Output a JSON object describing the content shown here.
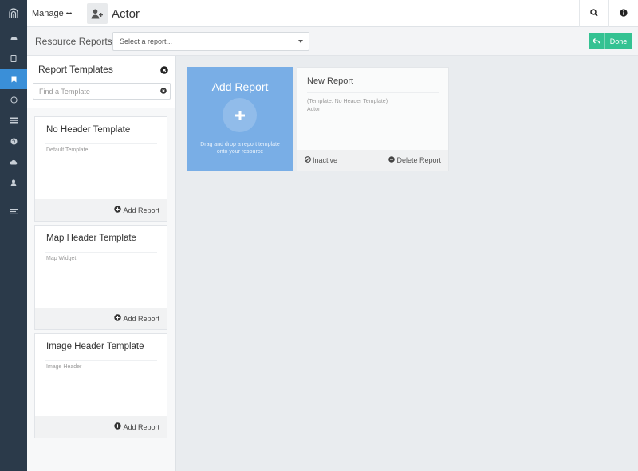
{
  "header": {
    "manage_label": "Manage",
    "more_glyph": "•••",
    "title": "Actor",
    "title_icon": "user-add-icon",
    "search_icon": "search-icon",
    "info_icon": "info-icon"
  },
  "nav": {
    "logo_icon": "logo-arch-icon",
    "items": [
      {
        "icon": "dashboard-icon",
        "active": false
      },
      {
        "icon": "book-icon",
        "active": false
      },
      {
        "icon": "bookmark-icon",
        "active": true
      },
      {
        "icon": "clock-icon",
        "active": false
      },
      {
        "icon": "list-icon",
        "active": false
      },
      {
        "icon": "globe-icon",
        "active": false
      },
      {
        "icon": "cloud-icon",
        "active": false
      },
      {
        "icon": "user-icon",
        "active": false
      },
      {
        "icon": "menu-lines-icon",
        "active": false
      }
    ]
  },
  "resource_bar": {
    "label": "Resource Reports",
    "select_value": "Select a report...",
    "done_label": "Done"
  },
  "templates": {
    "title": "Report Templates",
    "search_placeholder": "Find a Template",
    "items": [
      {
        "name": "No Header Template",
        "description": "Default Template",
        "action": "Add Report"
      },
      {
        "name": "Map Header Template",
        "description": "Map Widget",
        "action": "Add Report"
      },
      {
        "name": "Image Header Template",
        "description": "Image Header",
        "action": "Add Report"
      }
    ]
  },
  "main": {
    "add_report": {
      "title": "Add Report",
      "help": "Drag and drop a report template onto your resource"
    },
    "report_card": {
      "name": "New Report",
      "template": "(Template: No Header Template)",
      "resource": "Actor",
      "status": "Inactive",
      "delete_label": "Delete Report"
    }
  },
  "colors": {
    "nav_bg": "#2b3a4a",
    "nav_active": "#3a8fd8",
    "done_green": "#34c292",
    "add_report_blue": "#79aee6"
  }
}
